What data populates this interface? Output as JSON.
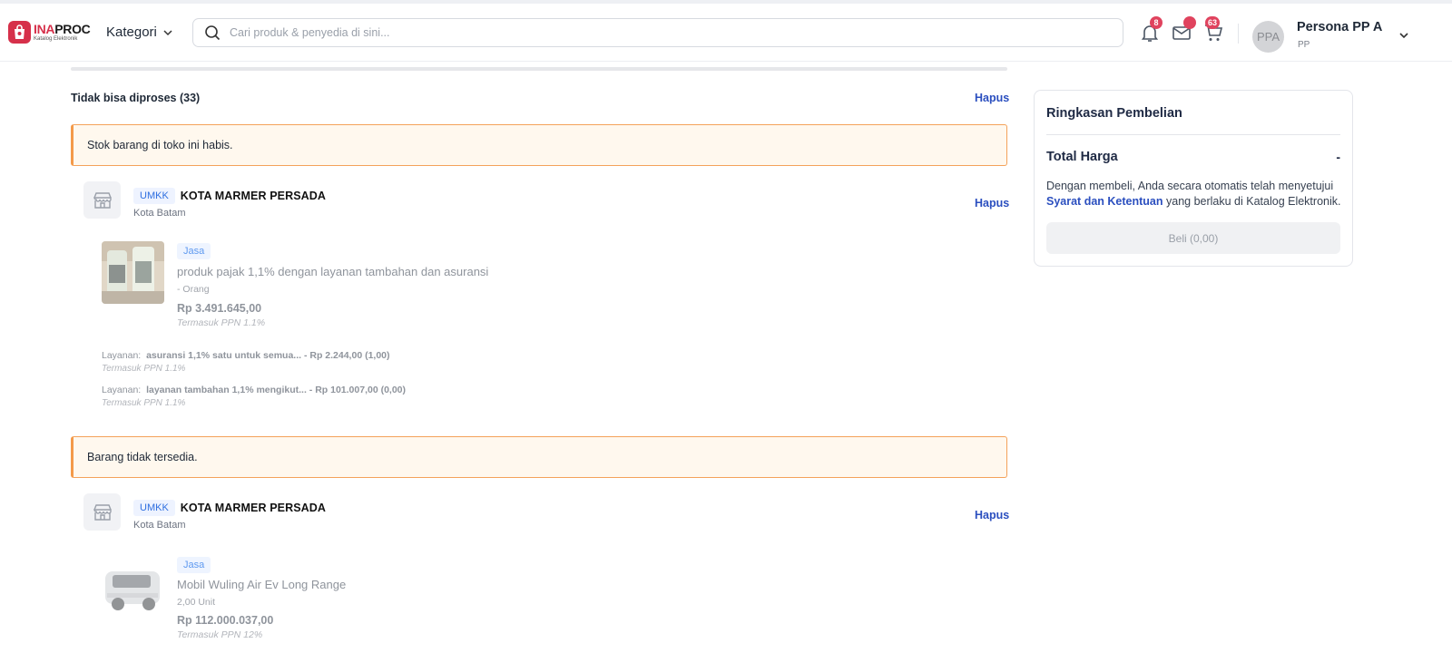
{
  "header": {
    "logo": {
      "brand": "INAPROC",
      "sub": "Katalog Elektronik"
    },
    "kategori_label": "Kategori",
    "search_placeholder": "Cari produk & penyedia di sini...",
    "notif_count": "8",
    "cart_count": "63",
    "user": {
      "initials": "PPA",
      "name": "Persona PP A",
      "role": "PP"
    }
  },
  "section": {
    "title": "Tidak bisa diproses (33)",
    "delete_label": "Hapus"
  },
  "groups": [
    {
      "alert": "Stok barang di toko ini habis.",
      "store": {
        "badge": "UMKK",
        "name": "KOTA MARMER PERSADA",
        "city": "Kota Batam",
        "delete_label": "Hapus"
      },
      "product": {
        "tag": "Jasa",
        "name": "produk pajak 1,1% dengan layanan tambahan dan asuransi",
        "unit": "- Orang",
        "price": "Rp 3.491.645,00",
        "ppn": "Termasuk PPN 1.1%"
      },
      "services": [
        {
          "label": "Layanan",
          "value": "asuransi 1,1% satu untuk semua... - Rp 2.244,00 (1,00)",
          "ppn": "Termasuk PPN 1.1%"
        },
        {
          "label": "Layanan",
          "value": "layanan tambahan 1,1% mengikut... - Rp 101.007,00 (0,00)",
          "ppn": "Termasuk PPN 1.1%"
        }
      ]
    },
    {
      "alert": "Barang tidak tersedia.",
      "store": {
        "badge": "UMKK",
        "name": "KOTA MARMER PERSADA",
        "city": "Kota Batam",
        "delete_label": "Hapus"
      },
      "product": {
        "tag": "Jasa",
        "name": "Mobil Wuling Air Ev Long Range",
        "unit": "2,00 Unit",
        "price": "Rp 112.000.037,00",
        "ppn": "Termasuk PPN 12%"
      }
    }
  ],
  "summary": {
    "title": "Ringkasan Pembelian",
    "total_label": "Total Harga",
    "total_value": "-",
    "terms_before": "Dengan membeli, Anda secara otomatis telah menyetujui",
    "terms_link": "Syarat dan Ketentuan",
    "terms_after": "yang berlaku di Katalog Elektronik.",
    "buy_label": "Beli (0,00)"
  },
  "colors": {
    "brand": "#d6304a",
    "link": "#2b4fbf",
    "alert_border": "#f4a25a",
    "alert_bg": "#fff8ee"
  }
}
